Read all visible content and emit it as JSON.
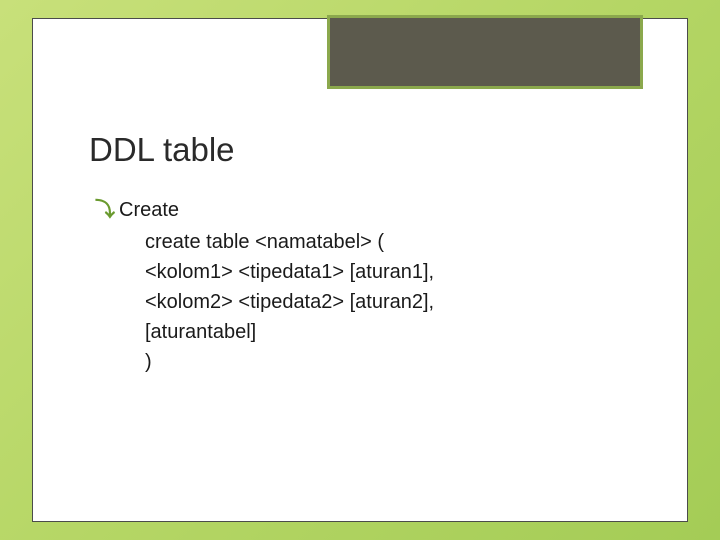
{
  "title": "DDL table",
  "bullet": {
    "head": "Create",
    "lines": [
      "create table <namatabel> (",
      "<kolom1> <tipedata1> [aturan1],",
      "<kolom2> <tipedata2> [aturan2],",
      "[aturantabel]",
      ")"
    ]
  }
}
